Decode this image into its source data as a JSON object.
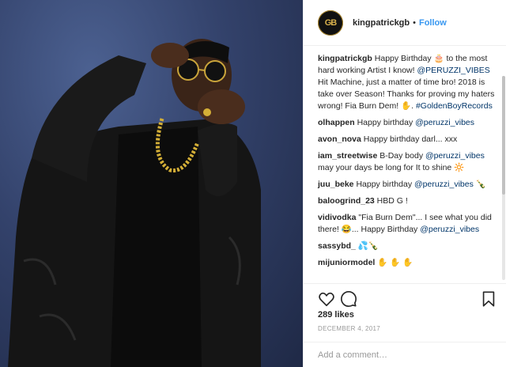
{
  "header": {
    "username": "kingpatrickgb",
    "separator": "•",
    "follow_label": "Follow",
    "avatar_label": "GB"
  },
  "caption": {
    "username": "kingpatrickgb",
    "text_1": " Happy Birthday 🎂 to the most hard working Artist I know! ",
    "mention": "@PERUZZI_VIBES",
    "text_2": " Hit Machine, just a matter of time bro! 2018 is take over Season! Thanks for proving my haters wrong! Fia Burn Dem! ✋. ",
    "hashtag": "#GoldenBoyRecords"
  },
  "comments": [
    {
      "user": "olhappen",
      "text": " Happy birthday ",
      "mention": "@peruzzi_vibes",
      "tail": ""
    },
    {
      "user": "avon_nova",
      "text": " Happy birthday darl... xxx",
      "mention": "",
      "tail": ""
    },
    {
      "user": "iam_streetwise",
      "text": " B-Day body ",
      "mention": "@peruzzi_vibes",
      "tail": " may your days be long for It to shine 🔆"
    },
    {
      "user": "juu_beke",
      "text": " Happy birthday ",
      "mention": "@peruzzi_vibes",
      "tail": " 🍾"
    },
    {
      "user": "baloogrind_23",
      "text": " HBD G !",
      "mention": "",
      "tail": ""
    },
    {
      "user": "vidivodka",
      "text": " \"Fia Burn Dem\"... I see what you did there! 😂... Happy Birthday ",
      "mention": "@peruzzi_vibes",
      "tail": ""
    },
    {
      "user": "sassybd_",
      "text": " 💦🍾",
      "mention": "",
      "tail": ""
    },
    {
      "user": "mijuniormodel",
      "text": " ✋ ✋ ✋",
      "mention": "",
      "tail": ""
    }
  ],
  "actions": {
    "like_icon": "heart-icon",
    "comment_icon": "speech-bubble-icon",
    "save_icon": "bookmark-icon"
  },
  "likes": "289 likes",
  "date": "DECEMBER 4, 2017",
  "add_comment": {
    "placeholder": "Add a comment…"
  },
  "colors": {
    "link": "#003569",
    "follow": "#3897f0",
    "photo_bg": "#33426b"
  }
}
